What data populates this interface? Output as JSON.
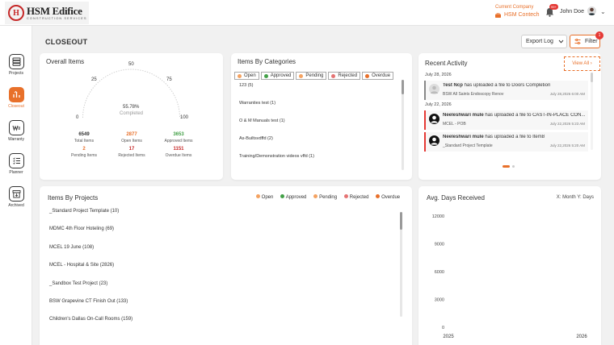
{
  "header": {
    "logo_title": "HSM Edifice",
    "logo_subtitle": "CONSTRUCTION SERVICES",
    "company_label": "Current Company",
    "company_name": "HSM Contech",
    "notification_count": "99+",
    "user_name": "John Doe"
  },
  "sidebar": {
    "items": [
      {
        "label": "Projects",
        "icon": "projects-icon",
        "active": false
      },
      {
        "label": "Closeout",
        "icon": "closeout-icon",
        "active": true
      },
      {
        "label": "Warranty",
        "icon": "warranty-icon",
        "active": false
      },
      {
        "label": "Planner",
        "icon": "planner-icon",
        "active": false
      },
      {
        "label": "Archived",
        "icon": "archive-icon",
        "active": false
      }
    ]
  },
  "page": {
    "title": "CLOSEOUT",
    "export_label": "Export Log",
    "filter_label": "Filter",
    "filter_count": "1"
  },
  "overall": {
    "title": "Overall Items",
    "gauge_ticks": [
      "0",
      "25",
      "50",
      "75",
      "100"
    ],
    "percent": "55.78%",
    "percent_value": 55.78,
    "completed_label": "Completed",
    "stats": [
      {
        "value": "6549",
        "label": "Total Items",
        "color": "#333333"
      },
      {
        "value": "2877",
        "label": "Open Items",
        "color": "#e8702a"
      },
      {
        "value": "3653",
        "label": "Approved Items",
        "color": "#43a047"
      },
      {
        "value": "2",
        "label": "Pending Items",
        "color": "#e8702a"
      },
      {
        "value": "17",
        "label": "Rejected Items",
        "color": "#c62828"
      },
      {
        "value": "1151",
        "label": "Overdue Items",
        "color": "#c62828"
      }
    ]
  },
  "categories": {
    "title": "Items By Categories",
    "legend": [
      {
        "label": "Open",
        "color": "#f4a261"
      },
      {
        "label": "Approved",
        "color": "#43a047"
      },
      {
        "label": "Pending",
        "color": "#f4a261"
      },
      {
        "label": "Rejected",
        "color": "#e57373"
      },
      {
        "label": "Overdue",
        "color": "#e8702a"
      }
    ],
    "items": [
      "123 (5)",
      "Warranties test (1)",
      "O & M Manuals test (1)",
      "As-Builtsvdffd (2)",
      "Training/Demonstration videos vffd (1)"
    ]
  },
  "activity": {
    "title": "Recent Activity",
    "view_all": "View All",
    "groups": [
      {
        "date": "July 28, 2026",
        "items": [
          {
            "user": "Test Ncp",
            "text": " has uploaded a file to Doors Completion",
            "project": "BSW All Saints Endoscopy Renov",
            "time": "July 28,2026 6:00 AM",
            "style": "grey"
          }
        ]
      },
      {
        "date": "July 22, 2026",
        "items": [
          {
            "user": "Neeleshwari mule",
            "text": " has uploaded a file to CAST-IN-PLACE CON...",
            "project": "MCEL - POB",
            "time": "July 22,2026 5:23 AM",
            "style": "red"
          },
          {
            "user": "Neeleshwari mule",
            "text": " has uploaded a file to Item8",
            "project": "_Standard Project Template",
            "time": "July 22,2026 5:20 AM",
            "style": "red"
          }
        ]
      }
    ]
  },
  "projects": {
    "title": "Items By Projects",
    "legend": [
      {
        "label": "Open",
        "color": "#f4a261"
      },
      {
        "label": "Approved",
        "color": "#43a047"
      },
      {
        "label": "Pending",
        "color": "#f4a261"
      },
      {
        "label": "Rejected",
        "color": "#e57373"
      },
      {
        "label": "Overdue",
        "color": "#e8702a"
      }
    ],
    "items": [
      "_Standard Project Template (10)",
      "MDMC 4th Floor Hoteling (69)",
      "MCEL 19 June (108)",
      "MCEL - Hospital & Site (2826)",
      "_Sandbox Test Project (23)",
      "BSW Grapevine CT Finish Out (133)",
      "Children's Dallas On-Call Rooms (159)"
    ]
  },
  "days": {
    "title": "Avg. Days Received",
    "axis_note": "X: Month Y: Days"
  },
  "chart_data": {
    "type": "line",
    "title": "Avg. Days Received",
    "xlabel": "",
    "ylabel": "",
    "x_ticks": [
      "2025",
      "2026"
    ],
    "y_ticks": [
      "0",
      "3000",
      "6000",
      "9000",
      "12000"
    ],
    "ylim": [
      0,
      12000
    ],
    "series": []
  }
}
